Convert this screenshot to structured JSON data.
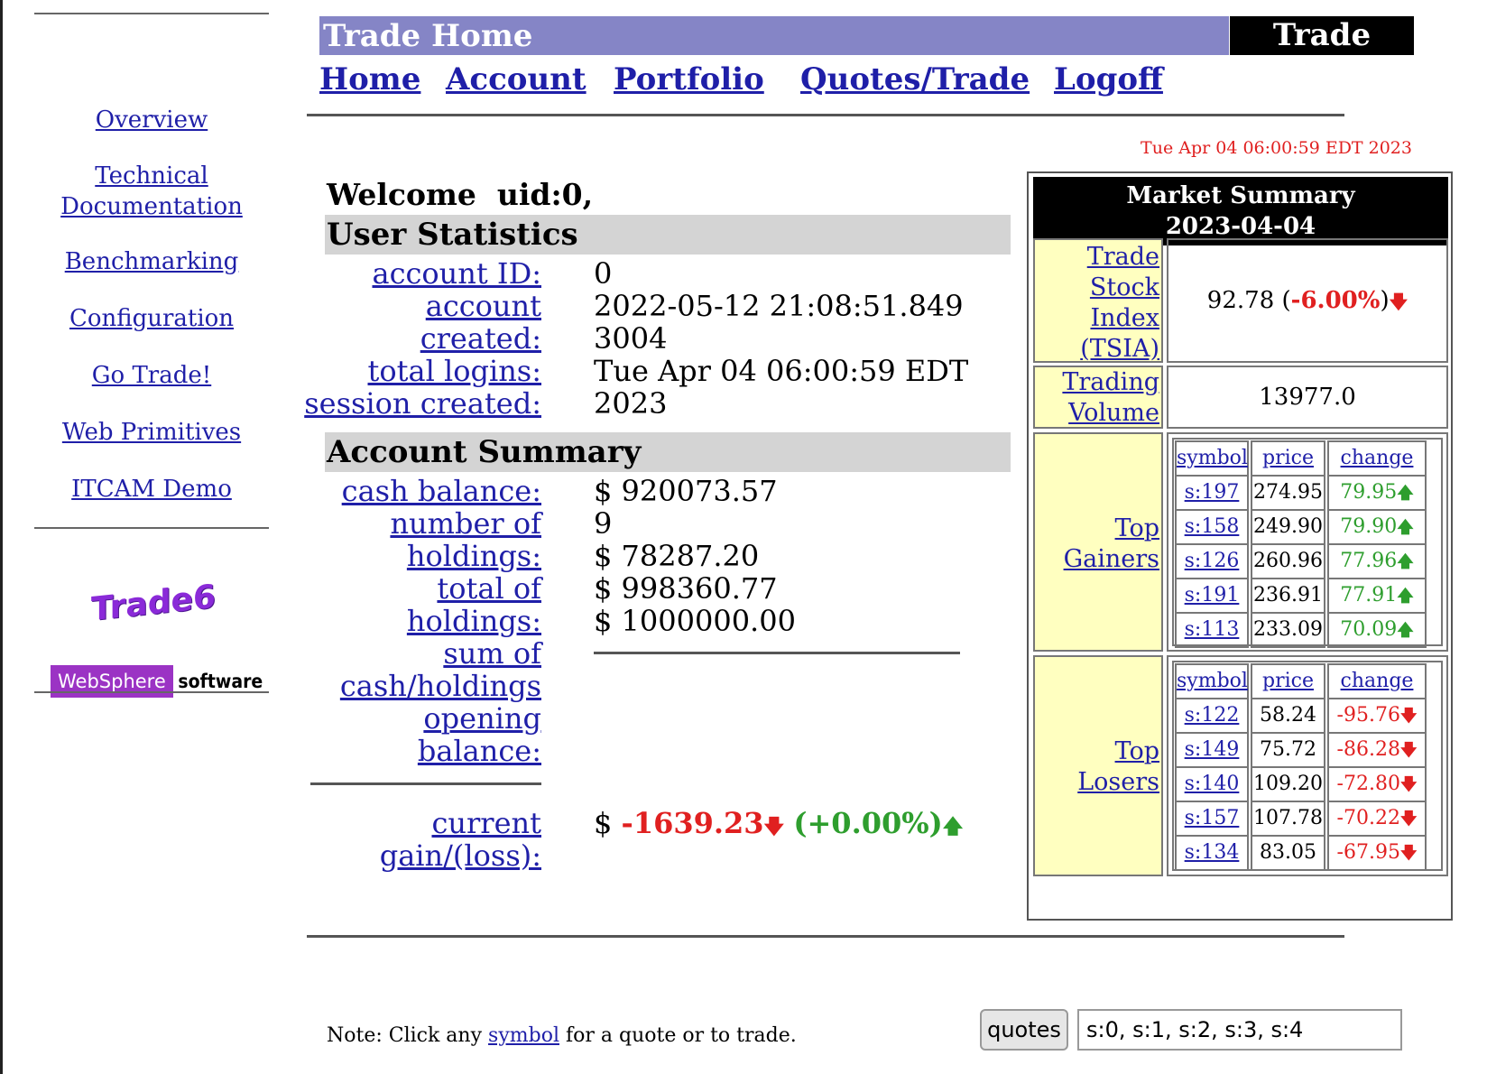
{
  "sidebar": {
    "nav": [
      "Overview",
      "Technical\nDocumentation",
      "Benchmarking",
      "Configuration",
      "Go Trade!",
      "Web Primitives",
      "ITCAM Demo"
    ],
    "logo_trade6": "Trade6",
    "logo_websphere": "WebSphere",
    "logo_software": "software"
  },
  "header": {
    "title": "Trade Home",
    "brand": "Trade",
    "nav": [
      "Home",
      "Account",
      "Portfolio",
      "Quotes/Trade",
      "Logoff"
    ],
    "date": "Tue Apr 04 06:00:59 EDT 2023"
  },
  "welcome": "Welcome  uid:0,",
  "user_stats": {
    "heading": "User Statistics",
    "labels": [
      "account ID:",
      "account",
      "created:",
      "total logins:",
      "session created:"
    ],
    "values": [
      "0",
      "2022-05-12 21:08:51.849",
      "3004",
      "Tue Apr 04 06:00:59 EDT",
      "2023"
    ]
  },
  "account_summary": {
    "heading": "Account Summary",
    "labels": [
      "cash balance:",
      "number of",
      "holdings:",
      "total of",
      "holdings:",
      "sum of",
      "cash/holdings",
      "opening",
      "balance:"
    ],
    "values": [
      "$ 920073.57",
      "9",
      "$ 78287.20",
      "$ 998360.77",
      "$ 1000000.00"
    ],
    "gain_label_1": "current",
    "gain_label_2": "gain/(loss):",
    "gain_dollar": "$ ",
    "gain_value": "-1639.23",
    "gain_pct": "(+0.00%)"
  },
  "market_summary": {
    "title_line1": "Market Summary",
    "title_line2": "2023-04-04",
    "tsia_label": [
      "Trade",
      "Stock",
      "Index",
      "(TSIA)"
    ],
    "tsia_value": "92.78",
    "tsia_change": "-6.00%",
    "volume_label": [
      "Trading",
      "Volume"
    ],
    "volume_value": "13977.0",
    "gainers_label": [
      "Top",
      "Gainers"
    ],
    "losers_label": [
      "Top",
      "Losers"
    ],
    "col_headers": [
      "symbol",
      "price",
      "change"
    ],
    "gainers": [
      {
        "symbol": "s:197",
        "price": "274.95",
        "change": "79.95"
      },
      {
        "symbol": "s:158",
        "price": "249.90",
        "change": "79.90"
      },
      {
        "symbol": "s:126",
        "price": "260.96",
        "change": "77.96"
      },
      {
        "symbol": "s:191",
        "price": "236.91",
        "change": "77.91"
      },
      {
        "symbol": "s:113",
        "price": "233.09",
        "change": "70.09"
      }
    ],
    "losers": [
      {
        "symbol": "s:122",
        "price": "58.24",
        "change": "-95.76"
      },
      {
        "symbol": "s:149",
        "price": "75.72",
        "change": "-86.28"
      },
      {
        "symbol": "s:140",
        "price": "109.20",
        "change": "-72.80"
      },
      {
        "symbol": "s:157",
        "price": "107.78",
        "change": "-70.22"
      },
      {
        "symbol": "s:134",
        "price": "83.05",
        "change": "-67.95"
      }
    ]
  },
  "footer": {
    "note_prefix": "Note: Click any ",
    "note_link": "symbol",
    "note_suffix": " for a quote or to trade.",
    "quotes_button": "quotes",
    "quotes_value": "s:0, s:1, s:2, s:3, s:4"
  },
  "colors": {
    "title_bar": "#8585c6",
    "link": "#1f1fa8",
    "negative": "#e02020",
    "positive": "#2e9e2e",
    "cell_yellow": "#ffffc0"
  }
}
